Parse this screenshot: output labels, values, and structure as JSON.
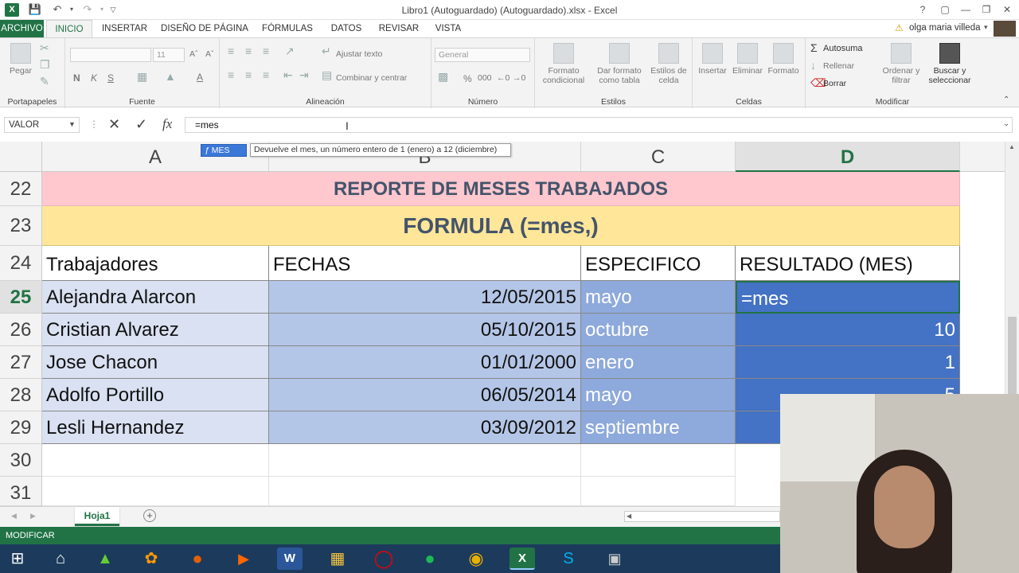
{
  "window": {
    "title": "Libro1 (Autoguardado) (Autoguardado).xlsx - Excel",
    "user": "olga maria villeda"
  },
  "tabs": [
    "ARCHIVO",
    "INICIO",
    "INSERTAR",
    "DISEÑO DE PÁGINA",
    "FÓRMULAS",
    "DATOS",
    "REVISAR",
    "VISTA"
  ],
  "ribbon": {
    "clipboard": {
      "label": "Portapapeles",
      "paste": "Pegar"
    },
    "font": {
      "label": "Fuente",
      "size": "11",
      "bold": "N",
      "italic": "K",
      "underline": "S"
    },
    "alignment": {
      "label": "Alineación",
      "wrap": "Ajustar texto",
      "merge": "Combinar y centrar"
    },
    "number": {
      "label": "Número",
      "format": "General"
    },
    "styles": {
      "label": "Estilos",
      "conditional": "Formato condicional",
      "table": "Dar formato como tabla",
      "cell_styles": "Estilos de celda"
    },
    "cells": {
      "label": "Celdas",
      "insert": "Insertar",
      "delete": "Eliminar",
      "format": "Formato"
    },
    "modify": {
      "label": "Modificar",
      "autosum": "Autosuma",
      "fill": "Rellenar",
      "clear": "Borrar",
      "sort": "Ordenar y filtrar",
      "find": "Buscar y seleccionar"
    }
  },
  "formula_bar": {
    "name_box": "VALOR",
    "value": "=mes"
  },
  "tooltip": {
    "function": "MES",
    "description": "Devuelve el mes, un número entero de 1 (enero) a 12 (diciembre)"
  },
  "columns": [
    "A",
    "B",
    "C",
    "D"
  ],
  "rows": [
    "22",
    "23",
    "24",
    "25",
    "26",
    "27",
    "28",
    "29",
    "30",
    "31"
  ],
  "sheet": {
    "title_row": "REPORTE DE MESES TRABAJADOS",
    "formula_row": "FORMULA (=mes,)",
    "headers": [
      "Trabajadores",
      "FECHAS",
      "ESPECIFICO",
      "RESULTADO (MES)"
    ],
    "data": [
      {
        "name": "Alejandra Alarcon",
        "date": "12/05/2015",
        "month": "mayo",
        "result": "=mes"
      },
      {
        "name": "Cristian Alvarez",
        "date": "05/10/2015",
        "month": "octubre",
        "result": "10"
      },
      {
        "name": "Jose Chacon",
        "date": "01/01/2000",
        "month": "enero",
        "result": "1"
      },
      {
        "name": "Adolfo Portillo",
        "date": "06/05/2014",
        "month": "mayo",
        "result": "5"
      },
      {
        "name": "Lesli Hernandez",
        "date": "03/09/2012",
        "month": "septiembre",
        "result": ""
      }
    ]
  },
  "sheet_tab": "Hoja1",
  "status": "MODIFICAR",
  "colors": {
    "excel_green": "#217346",
    "title_row_bg": "#ffc7ce",
    "formula_row_bg": "#ffe699",
    "name_col_bg": "#d9e1f2",
    "date_col_bg": "#b4c6e7",
    "month_col_bg": "#8ea9db",
    "result_col_bg": "#4472c4"
  }
}
